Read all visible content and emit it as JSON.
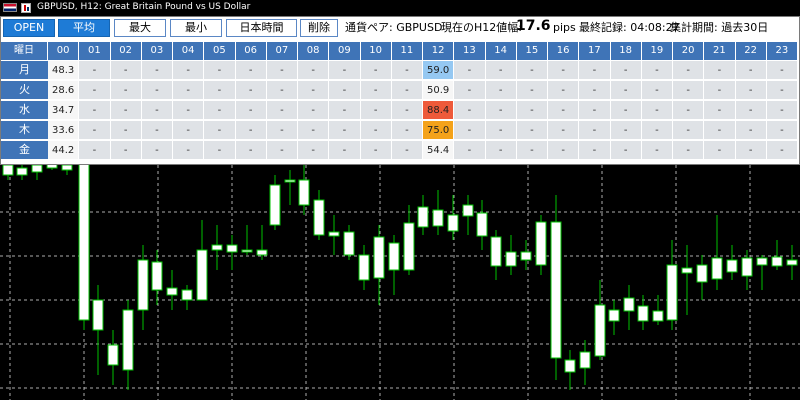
{
  "window": {
    "title": "GBPUSD, H12:  Great Britain Pound vs US Dollar"
  },
  "toolbar": {
    "buttons": [
      "OPEN",
      "平均",
      "最大",
      "最小",
      "日本時間",
      "削除"
    ],
    "pair_label": "通貨ペア: GBPUSD",
    "h12_label": "現在のH12値幅:",
    "h12_value": "17.6",
    "pips_label": "pips",
    "last_record": "最終記録: 04:08:27",
    "period": "集計期間: 過去30日"
  },
  "table": {
    "corner": "曜日",
    "hours": [
      "00",
      "01",
      "02",
      "03",
      "04",
      "05",
      "06",
      "07",
      "08",
      "09",
      "10",
      "11",
      "12",
      "13",
      "14",
      "15",
      "16",
      "17",
      "18",
      "19",
      "20",
      "21",
      "22",
      "23"
    ],
    "rows": [
      {
        "day": "月",
        "cells": [
          "48.3",
          "-",
          "-",
          "-",
          "-",
          "-",
          "-",
          "-",
          "-",
          "-",
          "-",
          "-",
          "59.0",
          "-",
          "-",
          "-",
          "-",
          "-",
          "-",
          "-",
          "-",
          "-",
          "-",
          "-"
        ]
      },
      {
        "day": "火",
        "cells": [
          "28.6",
          "-",
          "-",
          "-",
          "-",
          "-",
          "-",
          "-",
          "-",
          "-",
          "-",
          "-",
          "50.9",
          "-",
          "-",
          "-",
          "-",
          "-",
          "-",
          "-",
          "-",
          "-",
          "-",
          "-"
        ]
      },
      {
        "day": "水",
        "cells": [
          "34.7",
          "-",
          "-",
          "-",
          "-",
          "-",
          "-",
          "-",
          "-",
          "-",
          "-",
          "-",
          "88.4",
          "-",
          "-",
          "-",
          "-",
          "-",
          "-",
          "-",
          "-",
          "-",
          "-",
          "-"
        ]
      },
      {
        "day": "木",
        "cells": [
          "33.6",
          "-",
          "-",
          "-",
          "-",
          "-",
          "-",
          "-",
          "-",
          "-",
          "-",
          "-",
          "75.0",
          "-",
          "-",
          "-",
          "-",
          "-",
          "-",
          "-",
          "-",
          "-",
          "-",
          "-"
        ]
      },
      {
        "day": "金",
        "cells": [
          "44.2",
          "-",
          "-",
          "-",
          "-",
          "-",
          "-",
          "-",
          "-",
          "-",
          "-",
          "-",
          "54.4",
          "-",
          "-",
          "-",
          "-",
          "-",
          "-",
          "-",
          "-",
          "-",
          "-",
          "-"
        ]
      }
    ],
    "highlight": {
      "0": "blue",
      "2": "red",
      "3": "orange"
    }
  },
  "colors": {
    "bull": "#ffffff",
    "wick": "#00c000",
    "bg": "#000000",
    "grid": "#d8d8d8",
    "header": "#3f74b7"
  }
}
